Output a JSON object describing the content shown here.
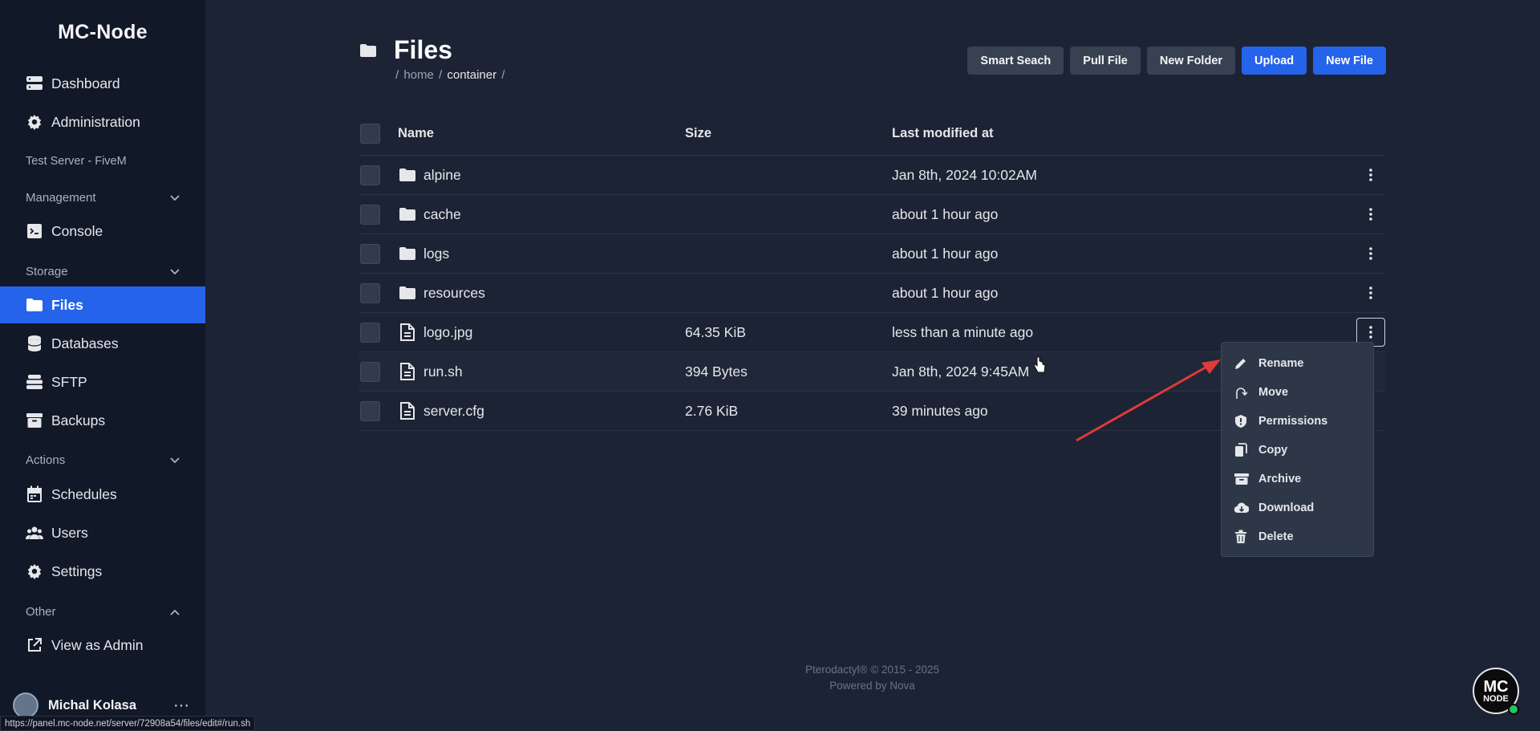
{
  "brand": "MC-Node",
  "sidebar": {
    "top_items": [
      {
        "label": "Dashboard",
        "icon": "server-stack-icon"
      },
      {
        "label": "Administration",
        "icon": "gear-icon"
      }
    ],
    "server_name": "Test Server - FiveM",
    "sections": {
      "management": {
        "label": "Management",
        "items": [
          {
            "label": "Console",
            "icon": "terminal-icon"
          }
        ]
      },
      "storage": {
        "label": "Storage",
        "items": [
          {
            "label": "Files",
            "icon": "folder-icon"
          },
          {
            "label": "Databases",
            "icon": "database-icon"
          },
          {
            "label": "SFTP",
            "icon": "layers-icon"
          },
          {
            "label": "Backups",
            "icon": "archive-icon"
          }
        ]
      },
      "actions": {
        "label": "Actions",
        "items": [
          {
            "label": "Schedules",
            "icon": "calendar-icon"
          },
          {
            "label": "Users",
            "icon": "users-icon"
          },
          {
            "label": "Settings",
            "icon": "gear-icon"
          }
        ]
      },
      "other": {
        "label": "Other",
        "items": [
          {
            "label": "View as Admin",
            "icon": "external-link-icon"
          }
        ]
      }
    },
    "user_name": "Michal Kolasa"
  },
  "page": {
    "title": "Files",
    "breadcrumb": {
      "home": "home",
      "current": "container",
      "sep": "/"
    }
  },
  "toolbar": {
    "smart_search": "Smart Seach",
    "pull_file": "Pull File",
    "new_folder": "New Folder",
    "upload": "Upload",
    "new_file": "New File"
  },
  "table": {
    "headers": {
      "name": "Name",
      "size": "Size",
      "modified": "Last modified at"
    },
    "rows": [
      {
        "name": "alpine",
        "type": "folder",
        "size": "",
        "modified": "Jan 8th, 2024 10:02AM"
      },
      {
        "name": "cache",
        "type": "folder",
        "size": "",
        "modified": "about 1 hour ago"
      },
      {
        "name": "logs",
        "type": "folder",
        "size": "",
        "modified": "about 1 hour ago"
      },
      {
        "name": "resources",
        "type": "folder",
        "size": "",
        "modified": "about 1 hour ago"
      },
      {
        "name": "logo.jpg",
        "type": "file",
        "size": "64.35 KiB",
        "modified": "less than a minute ago"
      },
      {
        "name": "run.sh",
        "type": "file",
        "size": "394 Bytes",
        "modified": "Jan 8th, 2024 9:45AM"
      },
      {
        "name": "server.cfg",
        "type": "file",
        "size": "2.76 KiB",
        "modified": "39 minutes ago"
      }
    ]
  },
  "context_menu": {
    "items": [
      {
        "label": "Rename",
        "icon": "pencil-icon"
      },
      {
        "label": "Move",
        "icon": "move-icon"
      },
      {
        "label": "Permissions",
        "icon": "shield-icon"
      },
      {
        "label": "Copy",
        "icon": "copy-icon"
      },
      {
        "label": "Archive",
        "icon": "archive-icon"
      },
      {
        "label": "Download",
        "icon": "cloud-download-icon"
      },
      {
        "label": "Delete",
        "icon": "trash-icon"
      }
    ]
  },
  "footer": {
    "line1": "Pterodactyl® © 2015 - 2025",
    "line2": "Powered by Nova"
  },
  "status_url": "https://panel.mc-node.net/server/72908a54/files/edit#/run.sh",
  "corner_logo": {
    "line1": "MC",
    "line2": "NODE"
  }
}
